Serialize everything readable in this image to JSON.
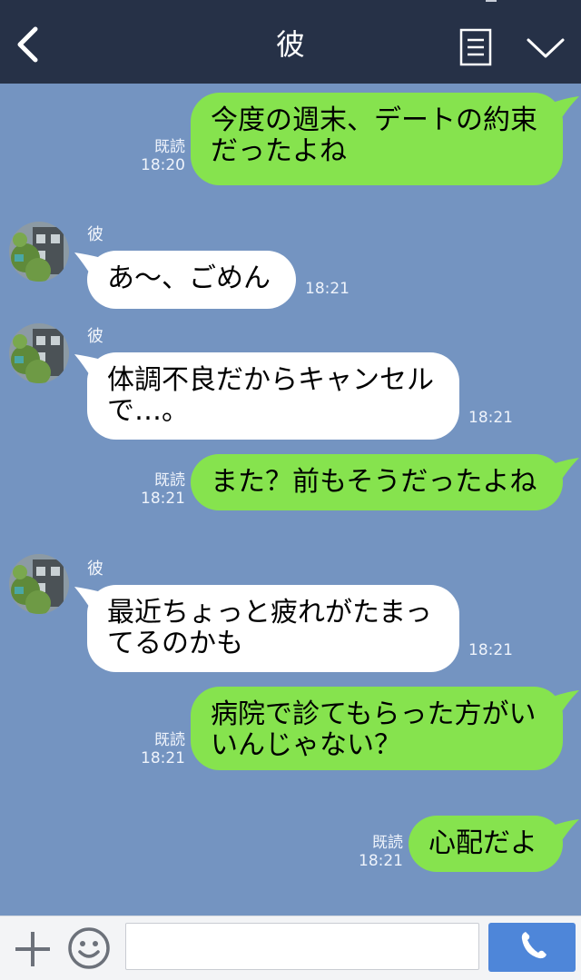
{
  "header": {
    "title": "彼",
    "back_icon": "chevron-left-icon",
    "menu_icon": "list-menu-icon",
    "collapse_icon": "chevron-down-icon"
  },
  "messages": [
    {
      "direction": "out",
      "text": "今度の週末、デートの約束\nだったよね",
      "read": "既読",
      "time": "18:20"
    },
    {
      "direction": "in",
      "sender": "彼",
      "text": "あ～、ごめん",
      "time": "18:21"
    },
    {
      "direction": "in",
      "sender": "彼",
      "text": "体調不良だからキャンセル\nで…。",
      "time": "18:21"
    },
    {
      "direction": "out",
      "text": "また？前もそうだったよね",
      "read": "既読",
      "time": "18:21"
    },
    {
      "direction": "in",
      "sender": "彼",
      "text": "最近ちょっと疲れがたまっ\nてるのかも",
      "time": "18:21"
    },
    {
      "direction": "out",
      "text": "病院で診てもらった方がい\nいんじゃない？",
      "read": "既読",
      "time": "18:21"
    },
    {
      "direction": "out",
      "text": "心配だよ",
      "read": "既読",
      "time": "18:21"
    }
  ],
  "footer": {
    "plus_icon": "plus-icon",
    "emoji_icon": "smiley-icon",
    "input_value": "",
    "call_icon": "phone-icon"
  },
  "colors": {
    "header_bg": "#263147",
    "chat_bg": "#7494c1",
    "outgoing_bubble": "#86e34e",
    "incoming_bubble": "#ffffff",
    "call_button": "#4e86d9"
  }
}
